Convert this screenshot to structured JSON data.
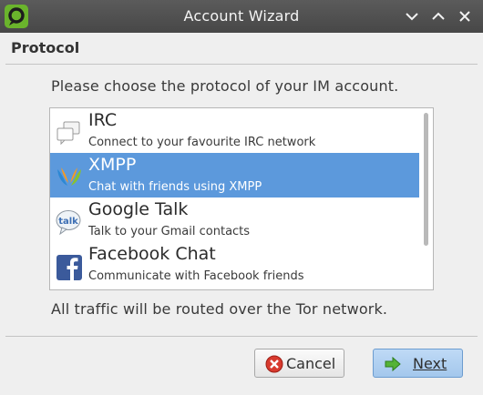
{
  "window": {
    "title": "Account Wizard",
    "app_icon": "tor-messenger-icon",
    "controls": [
      "chevron-down-icon",
      "chevron-up-icon",
      "close-icon"
    ]
  },
  "page": {
    "section_title": "Protocol",
    "prompt": "Please choose the protocol of your IM account.",
    "info": "All traffic will be routed over the Tor network."
  },
  "protocols": [
    {
      "name": "IRC",
      "description": "Connect to your favourite IRC network",
      "icon": "irc-icon",
      "selected": false
    },
    {
      "name": "XMPP",
      "description": "Chat with friends using XMPP",
      "icon": "xmpp-icon",
      "selected": true
    },
    {
      "name": "Google Talk",
      "description": "Talk to your Gmail contacts",
      "icon": "google-talk-icon",
      "selected": false
    },
    {
      "name": "Facebook Chat",
      "description": "Communicate with Facebook friends",
      "icon": "facebook-icon",
      "selected": false
    }
  ],
  "buttons": {
    "cancel": {
      "label": "Cancel",
      "icon": "cancel-icon"
    },
    "next": {
      "label": "Next",
      "icon": "arrow-right-icon"
    }
  },
  "colors": {
    "titlebar": "#4f4f4f",
    "selection": "#5c99dc",
    "background": "#efefef",
    "next_button": "#b1d0f1"
  }
}
